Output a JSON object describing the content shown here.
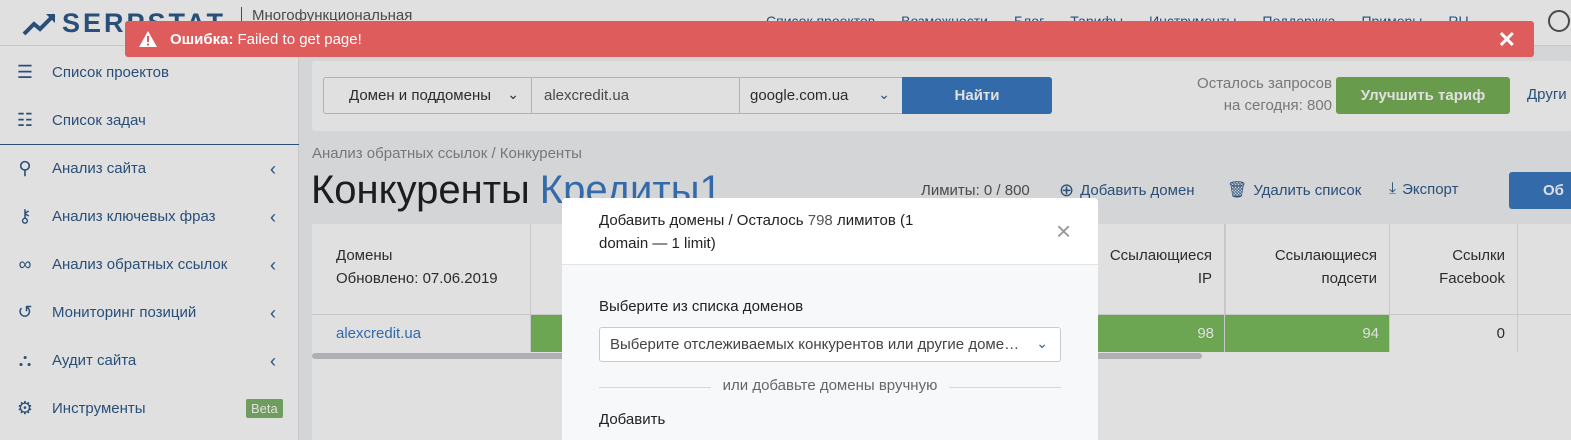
{
  "header": {
    "logo": "SERPSTAT",
    "tagline": "Многофункциональная",
    "nav": [
      "Список проектов",
      "Возможности",
      "Блог",
      "Тарифы",
      "Инструменты",
      "Поддержка",
      "Примеры",
      "RU"
    ]
  },
  "error": {
    "title": "Ошибка:",
    "message": "Failed to get page!"
  },
  "sidebar": {
    "items": [
      {
        "label": "Список проектов",
        "icon": "menu-icon"
      },
      {
        "label": "Список задач",
        "icon": "list-icon"
      },
      {
        "label": "Анализ сайта",
        "icon": "site-analysis-icon"
      },
      {
        "label": "Анализ ключевых фраз",
        "icon": "key-icon"
      },
      {
        "label": "Анализ обратных ссылок",
        "icon": "link-icon"
      },
      {
        "label": "Мониторинг позиций",
        "icon": "history-icon"
      },
      {
        "label": "Аудит сайта",
        "icon": "sitemap-icon"
      },
      {
        "label": "Инструменты",
        "icon": "gear-icon",
        "badge": "Beta"
      }
    ]
  },
  "search": {
    "scope": "Домен и поддомены",
    "query": "alexcredit.ua",
    "engine": "google.com.ua",
    "button": "Найти",
    "quota_line1": "Осталось запросов",
    "quota_line2": "на сегодня: 800",
    "upgrade": "Улучшить тариф",
    "others": "Други"
  },
  "page": {
    "breadcrumb": "Анализ обратных ссылок / Конкуренты",
    "title": "Конкуренты",
    "project": "Кредиты1",
    "limits": "Лимиты: 0 / 800",
    "add_domain": "Добавить домен",
    "delete_list": "Удалить список",
    "export": "Экспорт",
    "btn_partial": "Об"
  },
  "table": {
    "col_domain": "Домены",
    "updated": "Обновлено: 07.06.2019",
    "col_ip_1": "Ссылающиеся",
    "col_ip_2": "IP",
    "col_subnet_1": "Ссылающиеся",
    "col_subnet_2": "подсети",
    "col_fb_1": "Ссылки",
    "col_fb_2": "Facebook",
    "row": {
      "domain": "alexcredit.ua",
      "ip": "98",
      "subnets": "94",
      "facebook": "0"
    }
  },
  "modal": {
    "title_a": "Добавить домены / Осталось",
    "title_n": "798",
    "title_b": "лимитов (1 domain — 1 limit)",
    "choose_label": "Выберите из списка доменов",
    "select_placeholder": "Выберите отслеживаемых конкурентов или другие доме…",
    "or_text": "или добавьте домены вручную",
    "add_label": "Добавить"
  },
  "colors": {
    "accent": "#3b79c2",
    "error": "#de5c5c",
    "green": "#7cbd5e",
    "nav": "#2f5a8a"
  }
}
